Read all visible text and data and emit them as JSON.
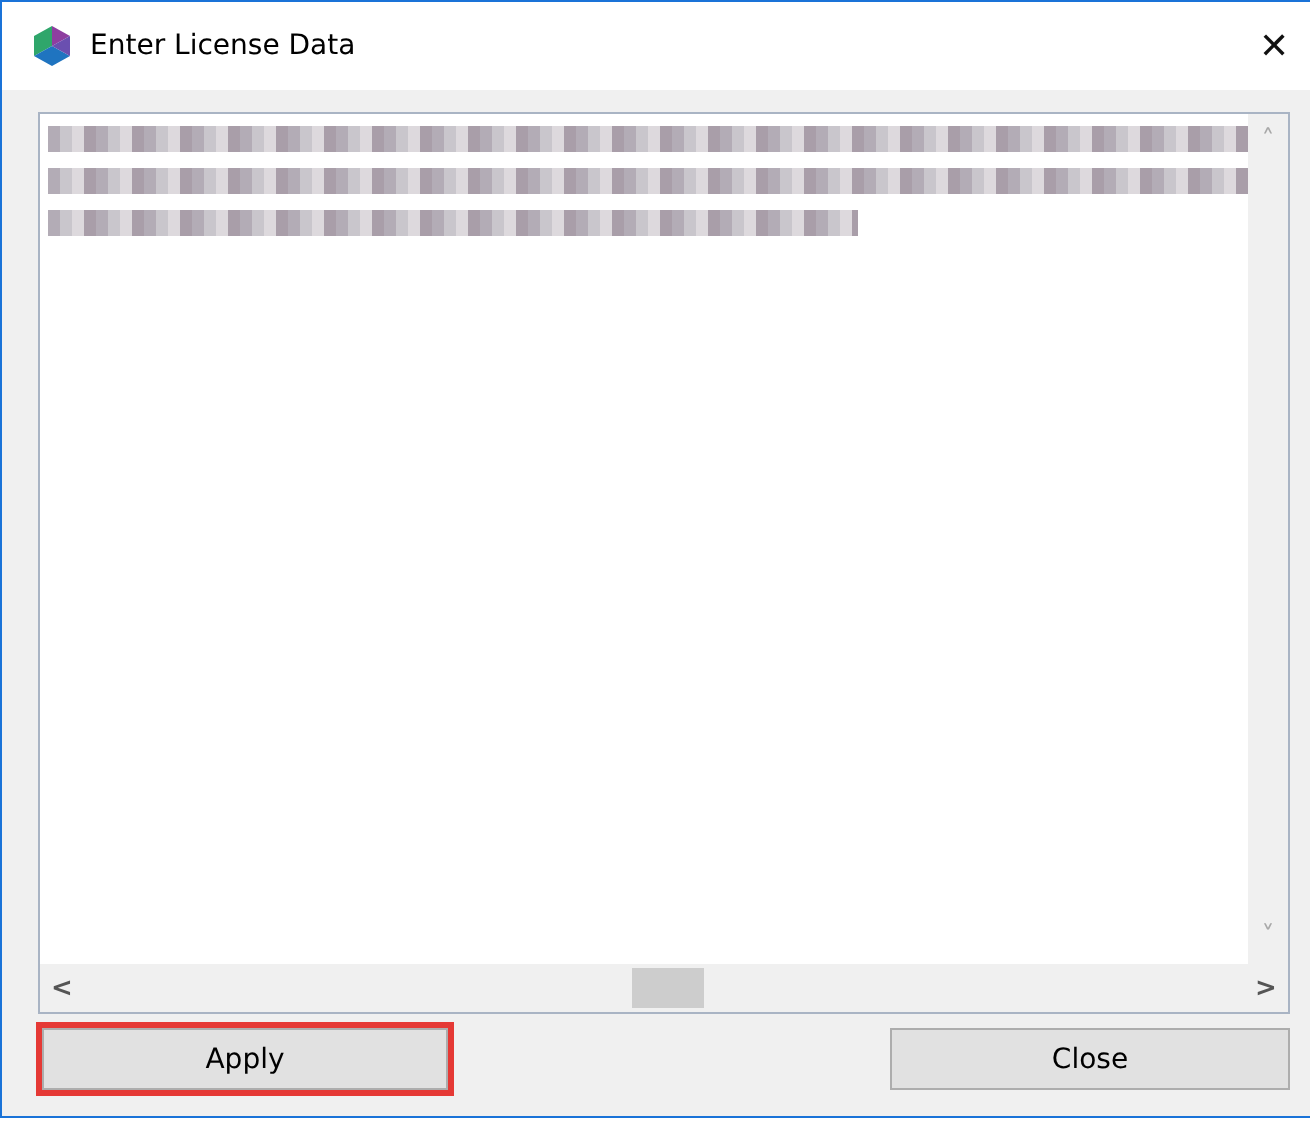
{
  "window": {
    "title": "Enter License Data",
    "close_glyph": "✕"
  },
  "scroll_arrows": {
    "up": "˄",
    "down": "˅",
    "left": "<",
    "right": ">"
  },
  "buttons": [
    {
      "label": "Apply",
      "highlighted": true
    },
    {
      "label": "Close",
      "highlighted": false
    }
  ]
}
